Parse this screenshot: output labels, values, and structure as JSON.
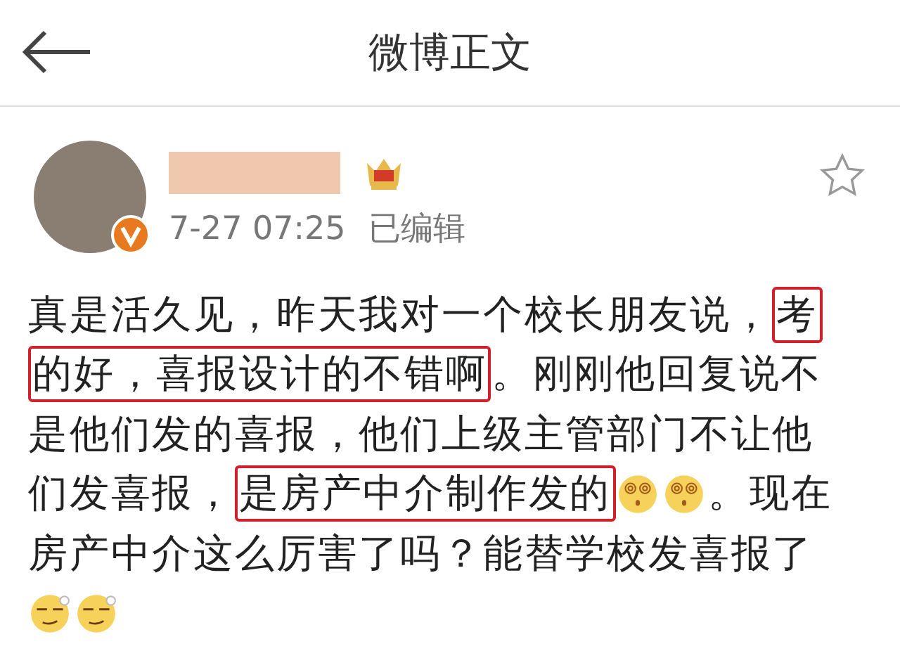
{
  "header": {
    "title": "微博正文"
  },
  "post": {
    "verified": true,
    "timestamp": "7-27 07:25",
    "edited_label": "已编辑",
    "lines": [
      [
        {
          "kind": "text",
          "text": "真是活久见，昨天我对一个校长朋友说，"
        },
        {
          "kind": "highlight",
          "text": "考"
        }
      ],
      [
        {
          "kind": "highlight",
          "text": "的好，喜报设计的不错啊"
        },
        {
          "kind": "text",
          "text": "。刚刚他回复说不"
        }
      ],
      [
        {
          "kind": "text",
          "text": "是他们发的喜报，他们上级主管部门不让他"
        }
      ],
      [
        {
          "kind": "text",
          "text": "们发喜报，"
        },
        {
          "kind": "highlight",
          "text": "是房产中介制作发的"
        },
        {
          "kind": "dizzy_emoji"
        },
        {
          "kind": "dizzy_emoji"
        },
        {
          "kind": "text",
          "text": "。现在"
        }
      ],
      [
        {
          "kind": "text",
          "text": "房产中介这么厉害了吗？能替学校发喜报了"
        }
      ],
      [
        {
          "kind": "smirk_emoji"
        },
        {
          "kind": "smirk_emoji"
        }
      ]
    ]
  }
}
